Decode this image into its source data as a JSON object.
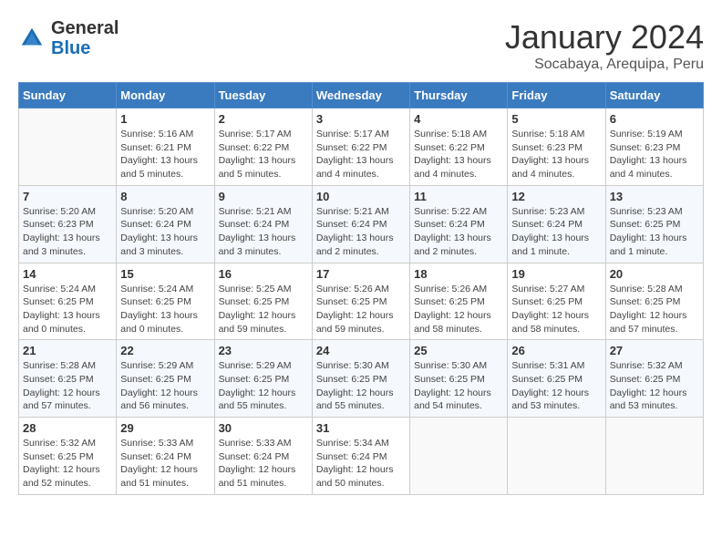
{
  "logo": {
    "text_general": "General",
    "text_blue": "Blue"
  },
  "header": {
    "month": "January 2024",
    "location": "Socabaya, Arequipa, Peru"
  },
  "weekdays": [
    "Sunday",
    "Monday",
    "Tuesday",
    "Wednesday",
    "Thursday",
    "Friday",
    "Saturday"
  ],
  "weeks": [
    [
      {
        "day": "",
        "info": ""
      },
      {
        "day": "1",
        "info": "Sunrise: 5:16 AM\nSunset: 6:21 PM\nDaylight: 13 hours\nand 5 minutes."
      },
      {
        "day": "2",
        "info": "Sunrise: 5:17 AM\nSunset: 6:22 PM\nDaylight: 13 hours\nand 5 minutes."
      },
      {
        "day": "3",
        "info": "Sunrise: 5:17 AM\nSunset: 6:22 PM\nDaylight: 13 hours\nand 4 minutes."
      },
      {
        "day": "4",
        "info": "Sunrise: 5:18 AM\nSunset: 6:22 PM\nDaylight: 13 hours\nand 4 minutes."
      },
      {
        "day": "5",
        "info": "Sunrise: 5:18 AM\nSunset: 6:23 PM\nDaylight: 13 hours\nand 4 minutes."
      },
      {
        "day": "6",
        "info": "Sunrise: 5:19 AM\nSunset: 6:23 PM\nDaylight: 13 hours\nand 4 minutes."
      }
    ],
    [
      {
        "day": "7",
        "info": "Sunrise: 5:20 AM\nSunset: 6:23 PM\nDaylight: 13 hours\nand 3 minutes."
      },
      {
        "day": "8",
        "info": "Sunrise: 5:20 AM\nSunset: 6:24 PM\nDaylight: 13 hours\nand 3 minutes."
      },
      {
        "day": "9",
        "info": "Sunrise: 5:21 AM\nSunset: 6:24 PM\nDaylight: 13 hours\nand 3 minutes."
      },
      {
        "day": "10",
        "info": "Sunrise: 5:21 AM\nSunset: 6:24 PM\nDaylight: 13 hours\nand 2 minutes."
      },
      {
        "day": "11",
        "info": "Sunrise: 5:22 AM\nSunset: 6:24 PM\nDaylight: 13 hours\nand 2 minutes."
      },
      {
        "day": "12",
        "info": "Sunrise: 5:23 AM\nSunset: 6:24 PM\nDaylight: 13 hours\nand 1 minute."
      },
      {
        "day": "13",
        "info": "Sunrise: 5:23 AM\nSunset: 6:25 PM\nDaylight: 13 hours\nand 1 minute."
      }
    ],
    [
      {
        "day": "14",
        "info": "Sunrise: 5:24 AM\nSunset: 6:25 PM\nDaylight: 13 hours\nand 0 minutes."
      },
      {
        "day": "15",
        "info": "Sunrise: 5:24 AM\nSunset: 6:25 PM\nDaylight: 13 hours\nand 0 minutes."
      },
      {
        "day": "16",
        "info": "Sunrise: 5:25 AM\nSunset: 6:25 PM\nDaylight: 12 hours\nand 59 minutes."
      },
      {
        "day": "17",
        "info": "Sunrise: 5:26 AM\nSunset: 6:25 PM\nDaylight: 12 hours\nand 59 minutes."
      },
      {
        "day": "18",
        "info": "Sunrise: 5:26 AM\nSunset: 6:25 PM\nDaylight: 12 hours\nand 58 minutes."
      },
      {
        "day": "19",
        "info": "Sunrise: 5:27 AM\nSunset: 6:25 PM\nDaylight: 12 hours\nand 58 minutes."
      },
      {
        "day": "20",
        "info": "Sunrise: 5:28 AM\nSunset: 6:25 PM\nDaylight: 12 hours\nand 57 minutes."
      }
    ],
    [
      {
        "day": "21",
        "info": "Sunrise: 5:28 AM\nSunset: 6:25 PM\nDaylight: 12 hours\nand 57 minutes."
      },
      {
        "day": "22",
        "info": "Sunrise: 5:29 AM\nSunset: 6:25 PM\nDaylight: 12 hours\nand 56 minutes."
      },
      {
        "day": "23",
        "info": "Sunrise: 5:29 AM\nSunset: 6:25 PM\nDaylight: 12 hours\nand 55 minutes."
      },
      {
        "day": "24",
        "info": "Sunrise: 5:30 AM\nSunset: 6:25 PM\nDaylight: 12 hours\nand 55 minutes."
      },
      {
        "day": "25",
        "info": "Sunrise: 5:30 AM\nSunset: 6:25 PM\nDaylight: 12 hours\nand 54 minutes."
      },
      {
        "day": "26",
        "info": "Sunrise: 5:31 AM\nSunset: 6:25 PM\nDaylight: 12 hours\nand 53 minutes."
      },
      {
        "day": "27",
        "info": "Sunrise: 5:32 AM\nSunset: 6:25 PM\nDaylight: 12 hours\nand 53 minutes."
      }
    ],
    [
      {
        "day": "28",
        "info": "Sunrise: 5:32 AM\nSunset: 6:25 PM\nDaylight: 12 hours\nand 52 minutes."
      },
      {
        "day": "29",
        "info": "Sunrise: 5:33 AM\nSunset: 6:24 PM\nDaylight: 12 hours\nand 51 minutes."
      },
      {
        "day": "30",
        "info": "Sunrise: 5:33 AM\nSunset: 6:24 PM\nDaylight: 12 hours\nand 51 minutes."
      },
      {
        "day": "31",
        "info": "Sunrise: 5:34 AM\nSunset: 6:24 PM\nDaylight: 12 hours\nand 50 minutes."
      },
      {
        "day": "",
        "info": ""
      },
      {
        "day": "",
        "info": ""
      },
      {
        "day": "",
        "info": ""
      }
    ]
  ]
}
